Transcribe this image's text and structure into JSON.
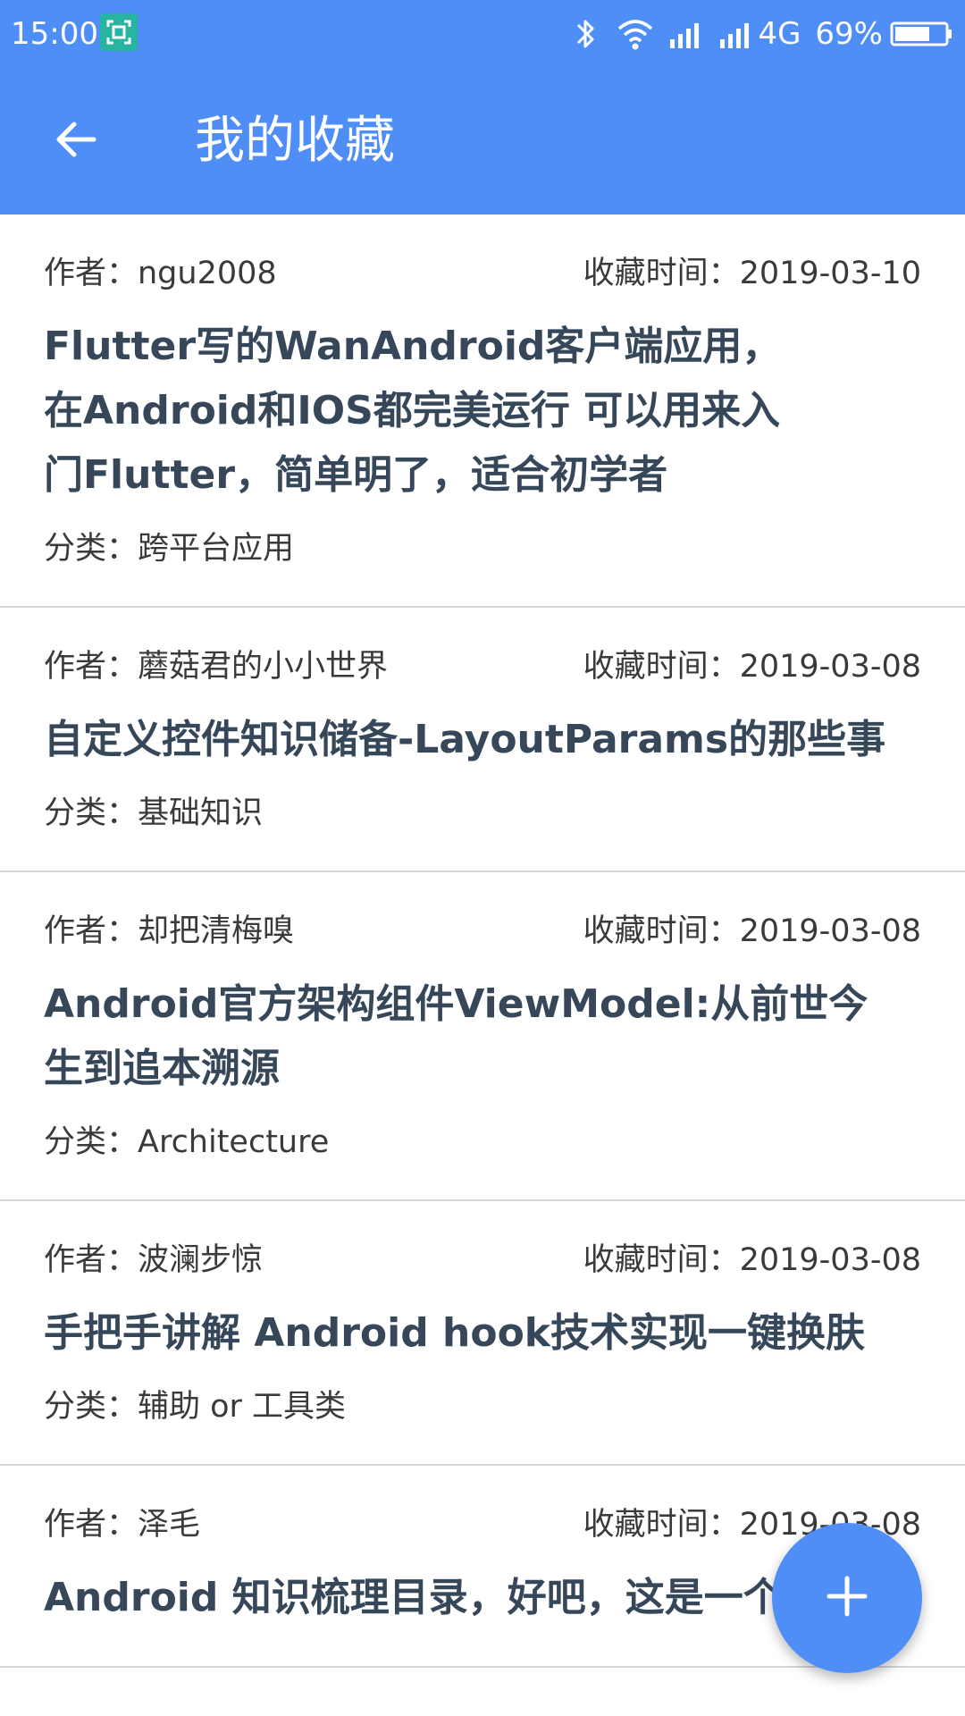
{
  "status_bar": {
    "time": "15:00",
    "network": "4G",
    "battery": "69%"
  },
  "app_bar": {
    "title": "我的收藏",
    "back_icon": "arrow-left-icon"
  },
  "articles": [
    {
      "author": "作者：ngu2008",
      "time": "收藏时间：2019-03-10",
      "title": "Flutter写的WanAndroid客户端应用，在Android和IOS都完美运行 可以用来入门Flutter，简单明了，适合初学者",
      "category": "分类：跨平台应用"
    },
    {
      "author": "作者：蘑菇君的小小世界",
      "time": "收藏时间：2019-03-08",
      "title": "自定义控件知识储备-LayoutParams的那些事",
      "category": "分类：基础知识"
    },
    {
      "author": "作者：却把清梅嗅",
      "time": "收藏时间：2019-03-08",
      "title": "Android官方架构组件ViewModel:从前世今生到追本溯源",
      "category": "分类：Architecture"
    },
    {
      "author": "作者：波澜步惊",
      "time": "收藏时间：2019-03-08",
      "title": "手把手讲解 Android hook技术实现一键换肤",
      "category": "分类：辅助 or 工具类"
    },
    {
      "author": "作者：泽毛",
      "time": "收藏时间：2019-03-08",
      "title": "Android 知识梳理目录，好吧，这是一个很",
      "category": ""
    }
  ],
  "fab": {
    "icon": "plus-icon"
  },
  "colors": {
    "primary": "#4f8ef7",
    "title_text": "#36475a",
    "meta_text": "#3a3a3a",
    "divider": "#d6d6d6"
  }
}
